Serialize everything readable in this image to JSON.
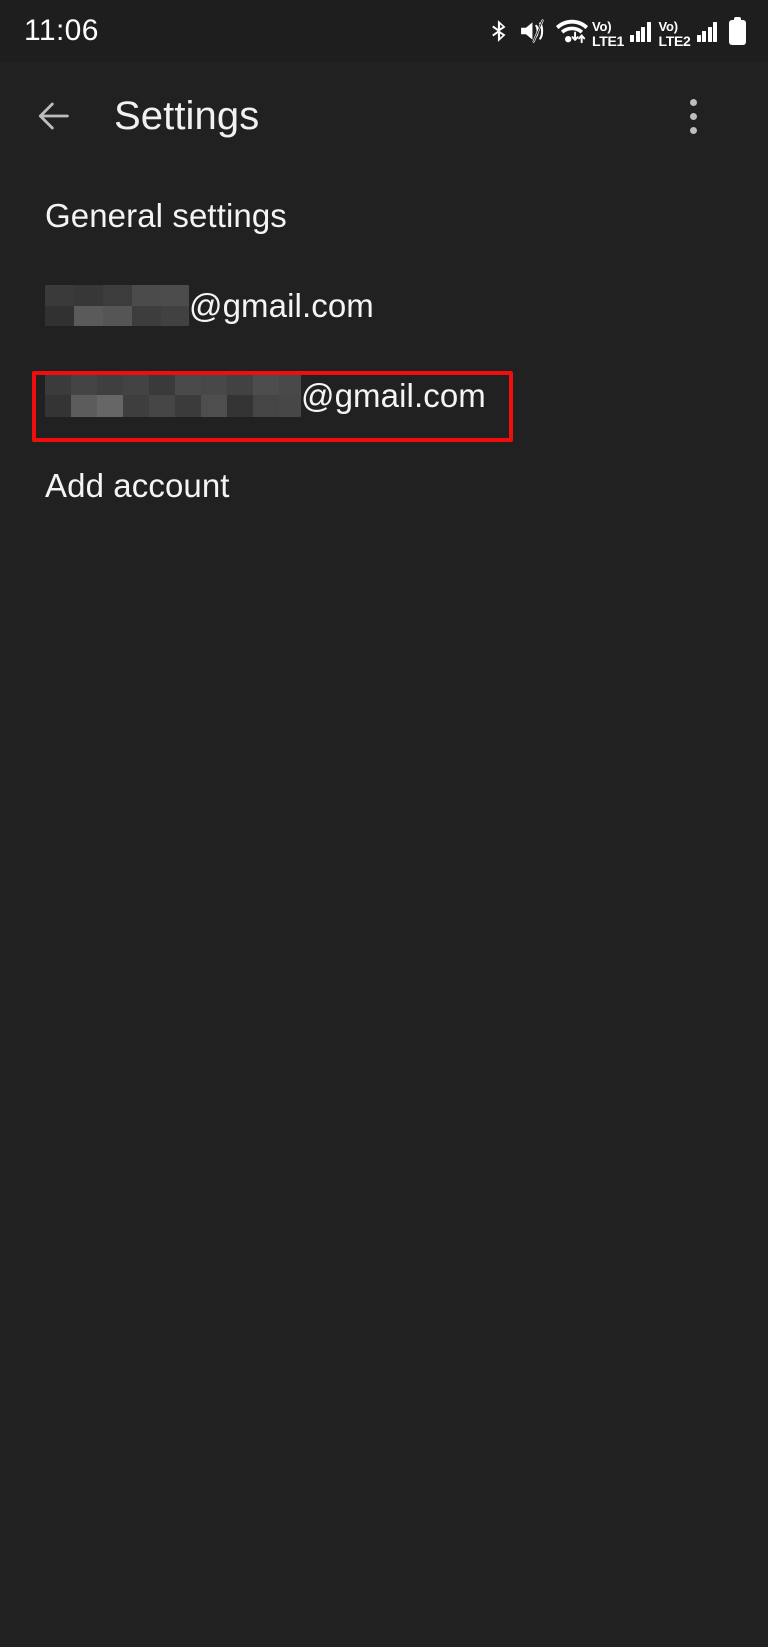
{
  "status_bar": {
    "clock": "11:06",
    "icons": [
      {
        "name": "bluetooth-icon",
        "label": "Bluetooth"
      },
      {
        "name": "mute-icon",
        "label": "Ringer muted"
      },
      {
        "name": "wifi-icon",
        "label": "Wi-Fi connected"
      },
      {
        "name": "volte-sim1-icon",
        "label": "Vo) LTE1"
      },
      {
        "name": "signal-sim1-icon",
        "label": "Signal SIM 1"
      },
      {
        "name": "volte-sim2-icon",
        "label": "Vo) LTE2"
      },
      {
        "name": "signal-sim2-icon",
        "label": "Signal SIM 2"
      },
      {
        "name": "battery-icon",
        "label": "Battery full"
      }
    ],
    "volte1": {
      "top": "Vo)",
      "bottom": "LTE1"
    },
    "volte2": {
      "top": "Vo)",
      "bottom": "LTE2"
    }
  },
  "app_bar": {
    "title": "Settings",
    "back_icon": "arrow-left-icon",
    "overflow_icon": "more-vert-icon"
  },
  "list": {
    "general_settings_label": "General settings",
    "accounts": [
      {
        "redacted": true,
        "domain": "@gmail.com",
        "highlighted": false
      },
      {
        "redacted": true,
        "domain": "@gmail.com",
        "highlighted": true
      }
    ],
    "add_account_label": "Add account"
  },
  "highlight": {
    "color": "#f00d0d",
    "target": "second-account-row"
  },
  "colors": {
    "background": "#212121",
    "status_bar_background": "#1e1e1e",
    "primary_text": "#f4f4f4",
    "icon": "#bdbdbd",
    "highlight": "#f00d0d"
  }
}
